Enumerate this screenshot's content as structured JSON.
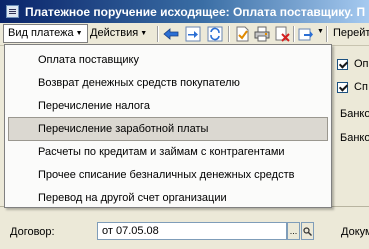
{
  "window": {
    "title": "Платежное поручение исходящее: Оплата поставщику. П"
  },
  "toolbar": {
    "menus": [
      {
        "label": "Вид платежа"
      },
      {
        "label": "Действия"
      }
    ],
    "right_label": "Перейти",
    "icons": [
      "arrow-left-icon",
      "arrow-right-icon",
      "refresh-icon",
      "post-icon",
      "print-icon",
      "delete-icon",
      "go-icon"
    ]
  },
  "dropdown": {
    "items": [
      {
        "label": "Оплата поставщику"
      },
      {
        "label": "Возврат денежных средств покупателю"
      },
      {
        "label": "Перечисление налога"
      },
      {
        "label": "Перечисление заработной платы"
      },
      {
        "label": "Расчеты по кредитам и займам с контрагентами"
      },
      {
        "label": "Прочее списание безналичных денежных средств"
      },
      {
        "label": "Перевод на другой счет организации"
      }
    ],
    "highlighted_index": 3
  },
  "right_panel": {
    "checkbox1_label": "Оп",
    "checkbox2_label": "Сп",
    "label3": "Банко",
    "label4": "Банко"
  },
  "contract": {
    "label": "Договор:",
    "value": "от 07.05.08",
    "select_button": "...",
    "right_label": "Докум"
  }
}
